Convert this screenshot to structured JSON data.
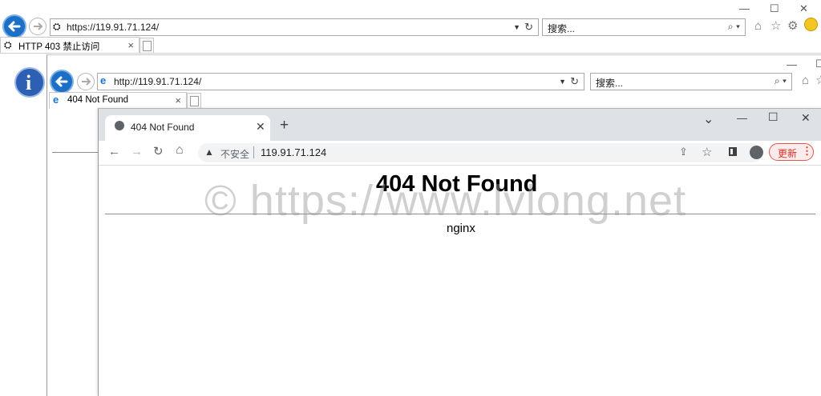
{
  "ie_back": {
    "address": "https://119.91.71.124/",
    "search_placeholder": "搜索...",
    "tab_title": "HTTP 403 禁止访问",
    "search_glyph": "⌕ ▾",
    "icons": [
      "home-icon",
      "star-icon",
      "gear-icon",
      "smiley-icon"
    ]
  },
  "ie_front": {
    "address": "http://119.91.71.124/",
    "search_placeholder": "搜索...",
    "tab_title": "404 Not Found"
  },
  "chrome": {
    "tab_title": "404 Not Found",
    "security_label": "不安全",
    "url": "119.91.71.124",
    "update_label": "更新",
    "new_tab": "+",
    "window_controls": {
      "dropdown": "⌄",
      "minimize": "—",
      "maximize": "☐",
      "close": "✕"
    }
  },
  "page": {
    "heading": "404 Not Found",
    "server": "nginx"
  },
  "watermark": {
    "text": "© https://www.lvlong.net"
  },
  "colors": {
    "ie_blue": "#1c6fc7",
    "chrome_strip": "#dee1e6",
    "update_red": "#d93025"
  }
}
